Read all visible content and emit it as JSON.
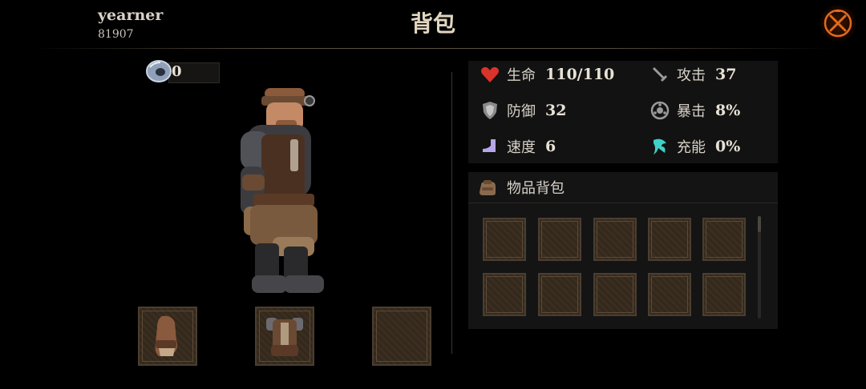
{
  "header": {
    "player_name": "yearner",
    "player_id": "81907",
    "title": "背包",
    "close_icon": "close-icon"
  },
  "currency": {
    "icon": "gem-ring-icon",
    "value": "0"
  },
  "equipment": {
    "slots": [
      {
        "name": "gloves",
        "icon": "leather-glove-icon",
        "filled": true
      },
      {
        "name": "armor",
        "icon": "chest-armor-icon",
        "filled": true
      },
      {
        "name": "empty",
        "icon": "",
        "filled": false
      }
    ]
  },
  "stats": {
    "hp": {
      "label": "生命",
      "value": "110/110",
      "icon": "heart-icon",
      "color": "#d9332b"
    },
    "attack": {
      "label": "攻击",
      "value": "37",
      "icon": "sword-icon"
    },
    "defense": {
      "label": "防御",
      "value": "32",
      "icon": "shield-icon"
    },
    "crit": {
      "label": "暴击",
      "value": "8%",
      "icon": "crit-icon"
    },
    "speed": {
      "label": "速度",
      "value": "6",
      "icon": "boot-icon",
      "color": "#b7a6e8"
    },
    "energy": {
      "label": "充能",
      "value": "0%",
      "icon": "energy-icon",
      "color": "#3fd1c8"
    }
  },
  "inventory": {
    "title": "物品背包",
    "icon": "bag-icon",
    "slot_count": 10
  },
  "colors": {
    "close_accent": "#e06a1c",
    "slot_border": "#4a3e30"
  }
}
